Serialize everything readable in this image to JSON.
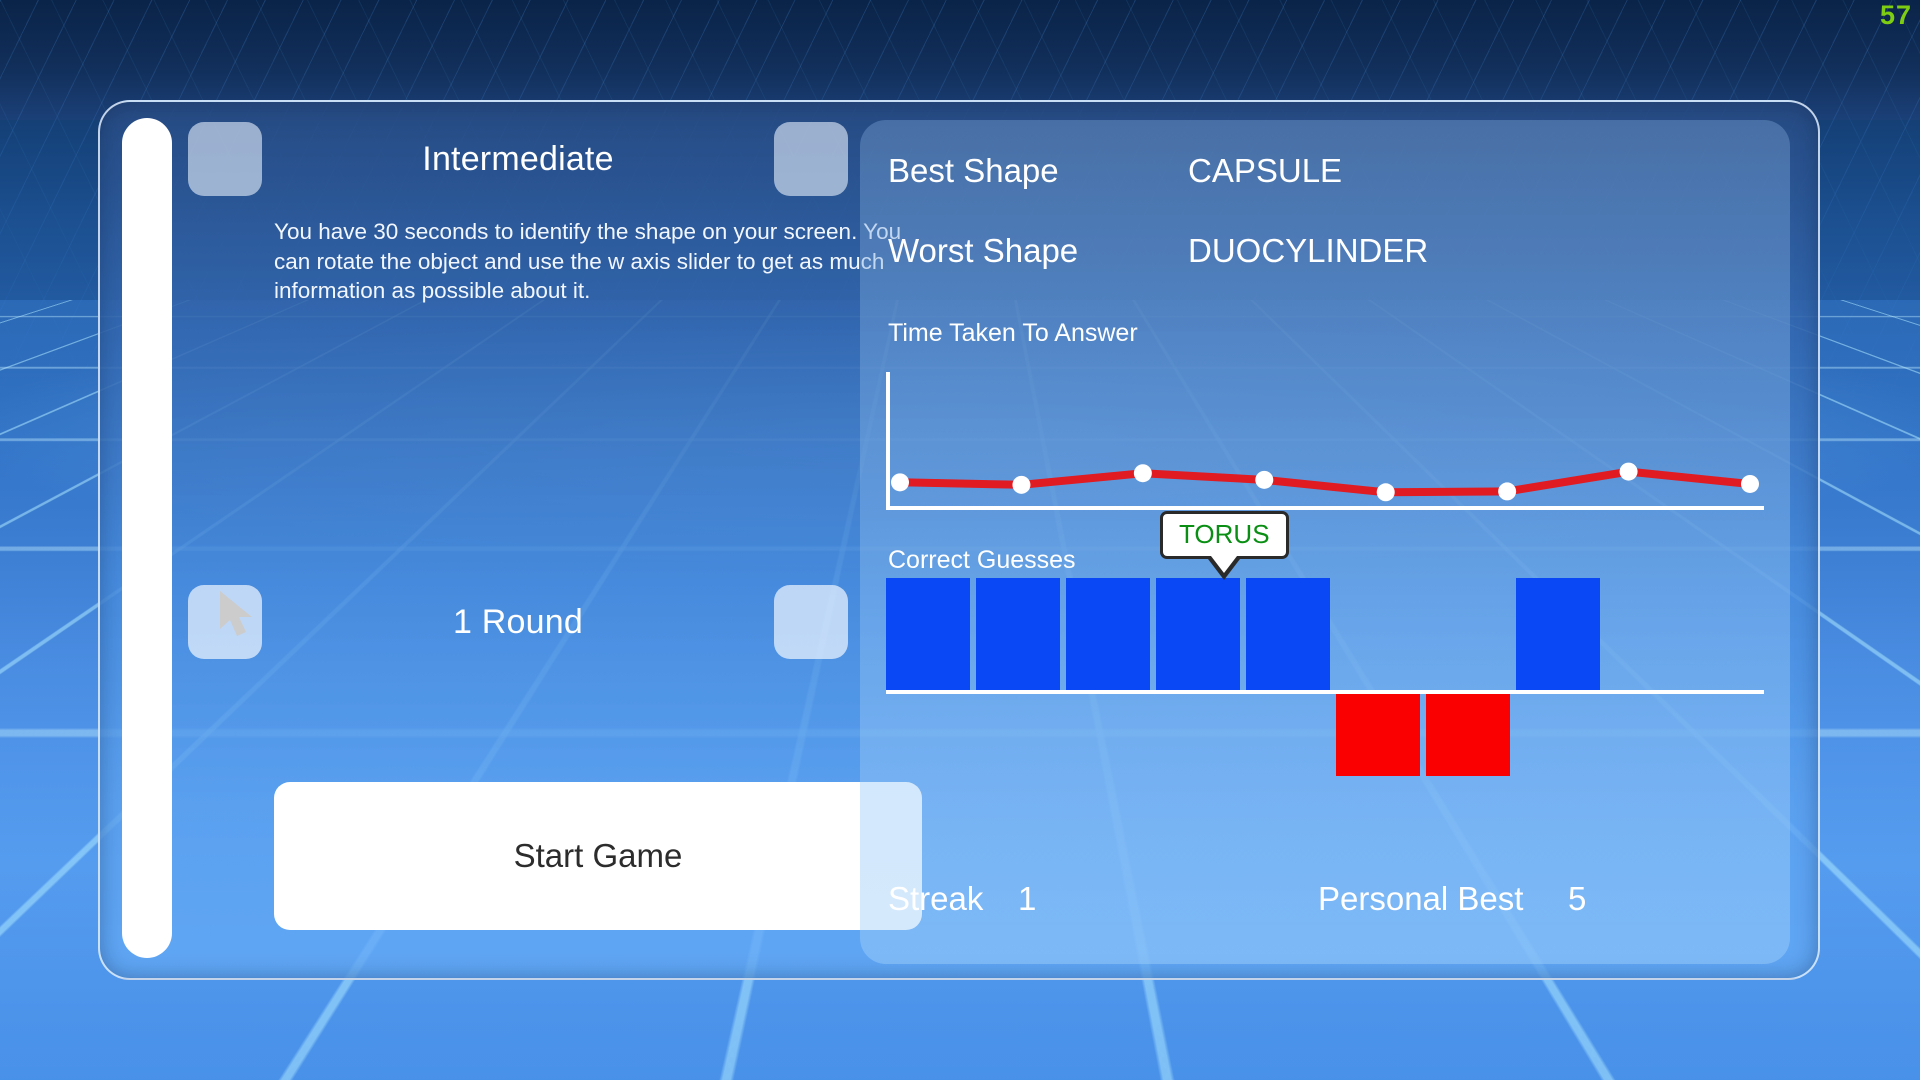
{
  "hud": {
    "fps": "57"
  },
  "settings": {
    "difficulty": {
      "label": "Intermediate",
      "prev_icon": "chevron-left-icon",
      "next_icon": "chevron-right-icon"
    },
    "description": "You have 30 seconds to identify the shape on your screen. You can rotate the object and use the w axis slider to get as much information as possible about it.",
    "rounds": {
      "label": "1 Round",
      "prev_icon": "chevron-left-icon",
      "next_icon": "chevron-right-icon"
    },
    "start_button": "Start Game",
    "w_axis_slider": {
      "name": "w-axis-slider",
      "value": 0
    }
  },
  "stats": {
    "best_shape": {
      "key": "Best Shape",
      "value": "CAPSULE"
    },
    "worst_shape": {
      "key": "Worst Shape",
      "value": "DUOCYLINDER"
    },
    "streak": {
      "key": "Streak",
      "value": "1"
    },
    "personal_best": {
      "key": "Personal Best",
      "value": "5"
    },
    "tooltip": {
      "label": "TORUS",
      "color": "#0a8f14"
    }
  },
  "colors": {
    "correct_bar": "#0a48f5",
    "wrong_bar": "#fa0000",
    "line": "#e01b22",
    "point": "#ffffff",
    "axis": "#ffffff",
    "fps": "#7ecd12"
  },
  "chart_data": [
    {
      "type": "line",
      "title": "Time Taken To Answer",
      "xlabel": "",
      "ylabel": "",
      "grid": false,
      "legend": "none",
      "axis_style": "L-shaped",
      "x": [
        1,
        2,
        3,
        4,
        5,
        6,
        7,
        8
      ],
      "values": [
        5.0,
        4.4,
        7.2,
        5.6,
        2.6,
        2.8,
        7.6,
        4.6
      ],
      "ylim": [
        0,
        30
      ],
      "series": [
        {
          "name": "Time Taken To Answer",
          "values": [
            5.0,
            4.4,
            7.2,
            5.6,
            2.6,
            2.8,
            7.6,
            4.6
          ]
        }
      ]
    },
    {
      "type": "bar",
      "title": "Correct Guesses",
      "xlabel": "",
      "ylabel": "",
      "grid": false,
      "legend": "none",
      "categories": [
        "1",
        "2",
        "3",
        "4",
        "5",
        "6",
        "7",
        "8"
      ],
      "values": [
        1,
        1,
        1,
        1,
        1,
        -1,
        -1,
        1
      ],
      "ylim": [
        -1,
        1
      ],
      "annotations": [
        {
          "category": "5",
          "text": "TORUS"
        }
      ]
    }
  ]
}
